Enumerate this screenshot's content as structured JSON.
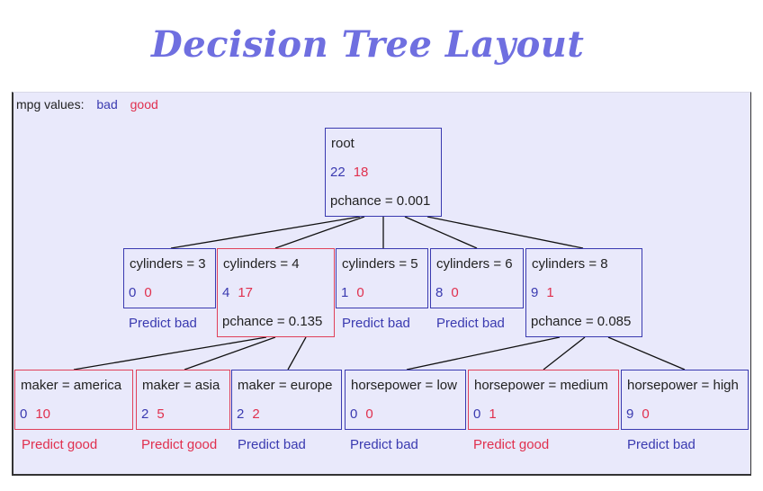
{
  "title": "Decision Tree Layout",
  "legend": {
    "label": "mpg values:",
    "classes": [
      {
        "name": "bad",
        "color": "#3a3ab0"
      },
      {
        "name": "good",
        "color": "#e0304e"
      }
    ]
  },
  "nodes": {
    "root": {
      "label": "root",
      "bad": "22",
      "good": "18",
      "pchance": "pchance = 0.001"
    },
    "cyl3": {
      "label": "cylinders = 3",
      "bad": "0",
      "good": "0",
      "prediction": "Predict bad"
    },
    "cyl4": {
      "label": "cylinders = 4",
      "bad": "4",
      "good": "17",
      "pchance": "pchance = 0.135"
    },
    "cyl5": {
      "label": "cylinders = 5",
      "bad": "1",
      "good": "0",
      "prediction": "Predict bad"
    },
    "cyl6": {
      "label": "cylinders = 6",
      "bad": "8",
      "good": "0",
      "prediction": "Predict bad"
    },
    "cyl8": {
      "label": "cylinders = 8",
      "bad": "9",
      "good": "1",
      "pchance": "pchance = 0.085"
    },
    "america": {
      "label": "maker = america",
      "bad": "0",
      "good": "10",
      "prediction": "Predict good"
    },
    "asia": {
      "label": "maker = asia",
      "bad": "2",
      "good": "5",
      "prediction": "Predict good"
    },
    "europe": {
      "label": "maker = europe",
      "bad": "2",
      "good": "2",
      "prediction": "Predict bad"
    },
    "hplow": {
      "label": "horsepower = low",
      "bad": "0",
      "good": "0",
      "prediction": "Predict bad"
    },
    "hpmed": {
      "label": "horsepower = medium",
      "bad": "0",
      "good": "1",
      "prediction": "Predict good"
    },
    "hphigh": {
      "label": "horsepower = high",
      "bad": "9",
      "good": "0",
      "prediction": "Predict bad"
    }
  },
  "edges": [
    [
      "root",
      "cyl3"
    ],
    [
      "root",
      "cyl4"
    ],
    [
      "root",
      "cyl5"
    ],
    [
      "root",
      "cyl6"
    ],
    [
      "root",
      "cyl8"
    ],
    [
      "cyl4",
      "america"
    ],
    [
      "cyl4",
      "asia"
    ],
    [
      "cyl4",
      "europe"
    ],
    [
      "cyl8",
      "hplow"
    ],
    [
      "cyl8",
      "hpmed"
    ],
    [
      "cyl8",
      "hphigh"
    ]
  ]
}
